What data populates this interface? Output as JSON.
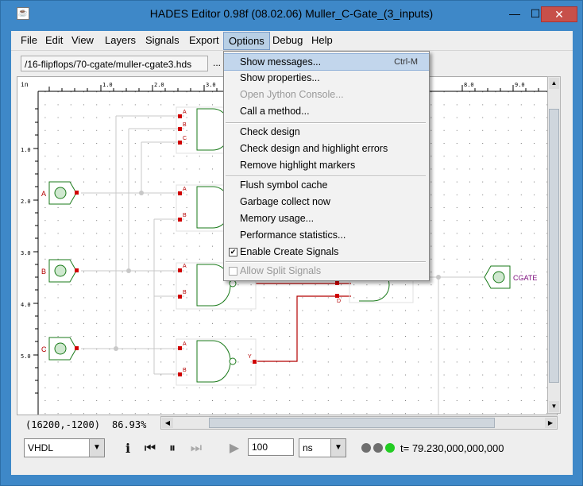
{
  "window": {
    "title": "HADES Editor 0.98f (08.02.06)    Muller_C-Gate_(3_inputs)",
    "minimize": "—",
    "maximize": "☐",
    "close": "✕"
  },
  "menubar": [
    "File",
    "Edit",
    "View",
    "Layers",
    "Signals",
    "Export",
    "Options",
    "Debug",
    "Help"
  ],
  "path": {
    "value": "/16-flipflops/70-cgate/muller-cgate3.hds",
    "more": "..."
  },
  "ruler": {
    "unit": "in",
    "ticks": [
      "1.0",
      "2.0",
      "3.0",
      "8.0",
      "9.0"
    ],
    "vticks": [
      "1.0",
      "2.0",
      "3.0",
      "4.0",
      "5.0"
    ]
  },
  "options_menu": {
    "items": [
      {
        "label": "Show messages...",
        "accelerator": "Ctrl-M",
        "state": "highlighted"
      },
      {
        "label": "Show properties...",
        "accelerator": "",
        "state": "normal"
      },
      {
        "label": "Open Jython Console...",
        "accelerator": "",
        "state": "disabled"
      },
      {
        "label": "Call a method...",
        "accelerator": "",
        "state": "normal"
      },
      {
        "label": "Check design",
        "accelerator": "",
        "state": "normal"
      },
      {
        "label": "Check design and highlight errors",
        "accelerator": "",
        "state": "normal"
      },
      {
        "label": "Remove highlight markers",
        "accelerator": "",
        "state": "normal"
      },
      {
        "label": "Flush symbol cache",
        "accelerator": "",
        "state": "normal"
      },
      {
        "label": "Garbage collect now",
        "accelerator": "",
        "state": "normal"
      },
      {
        "label": "Memory usage...",
        "accelerator": "",
        "state": "normal"
      },
      {
        "label": "Performance statistics...",
        "accelerator": "",
        "state": "normal"
      },
      {
        "label": "Enable Create Signals",
        "accelerator": "",
        "state": "checked"
      },
      {
        "label": "Allow Split Signals",
        "accelerator": "",
        "state": "disabled-checkbox"
      }
    ]
  },
  "schematic": {
    "inputs": [
      "A",
      "B",
      "C"
    ],
    "output": "CGATE",
    "gate_pins": [
      "A",
      "B",
      "C",
      "A",
      "B",
      "A",
      "B",
      "A",
      "B",
      "D",
      "Y"
    ]
  },
  "status": {
    "coords": "(16200,-1200)",
    "zoom": "86.93%"
  },
  "bottom": {
    "language": "VHDL",
    "time_step": "100",
    "time_unit": "ns",
    "time": "t= 79.230,000,000,000",
    "info_icon": "i"
  },
  "colors": {
    "title_bar": "#3e88c8",
    "signal_active": "#b40000",
    "led_green": "#22cc22",
    "led_gray": "#6e6e6e"
  }
}
